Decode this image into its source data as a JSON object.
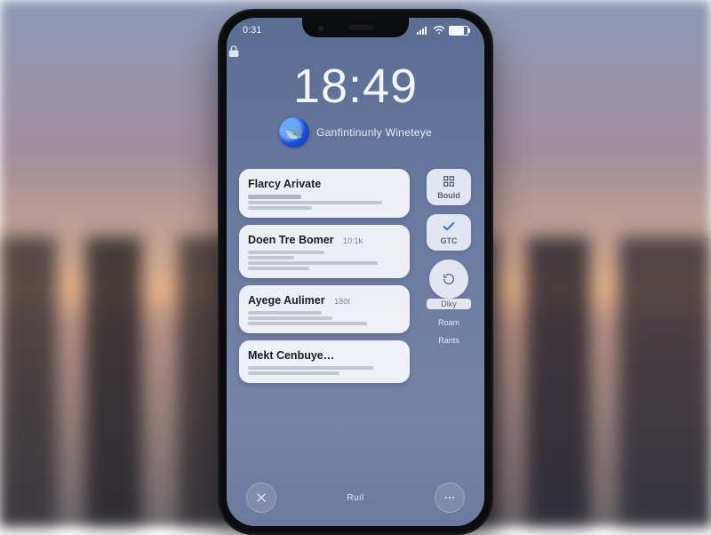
{
  "status_bar": {
    "time_small": "0:31",
    "signal_icon": "signal-icon",
    "wifi_icon": "wifi-icon",
    "battery_icon": "battery-icon"
  },
  "lock_screen": {
    "lock_icon": "lock-icon",
    "clock": "18:49",
    "avatar_icon": "globe-icon",
    "subtitle": "Ganfintinunly Wineteye"
  },
  "notifications": [
    {
      "title": "Flarcy Arivate",
      "meta": "",
      "lines": 3
    },
    {
      "title": "Doen Tre Bomer",
      "meta": "10:1k",
      "lines": 4
    },
    {
      "title": "Ayege Aulimer",
      "meta": "18öt",
      "lines": 3
    },
    {
      "title": "Mekt Cenbuye…",
      "meta": "",
      "lines": 2
    }
  ],
  "side_widgets": [
    {
      "icon": "grid-icon",
      "label": "Bould"
    },
    {
      "icon": "check-icon",
      "label": "GTC"
    },
    {
      "icon": "refresh-icon",
      "label": "Dlky"
    },
    {
      "plainLabels": [
        "Roam",
        "Rants"
      ]
    }
  ],
  "bottom_bar": {
    "left_icon": "close-icon",
    "center_label": "Ruil",
    "right_icon": "more-icon"
  },
  "colors": {
    "accent": "#2d6fe3",
    "card_bg": "#f5f7fc",
    "screen_top": "#5b6d93"
  }
}
